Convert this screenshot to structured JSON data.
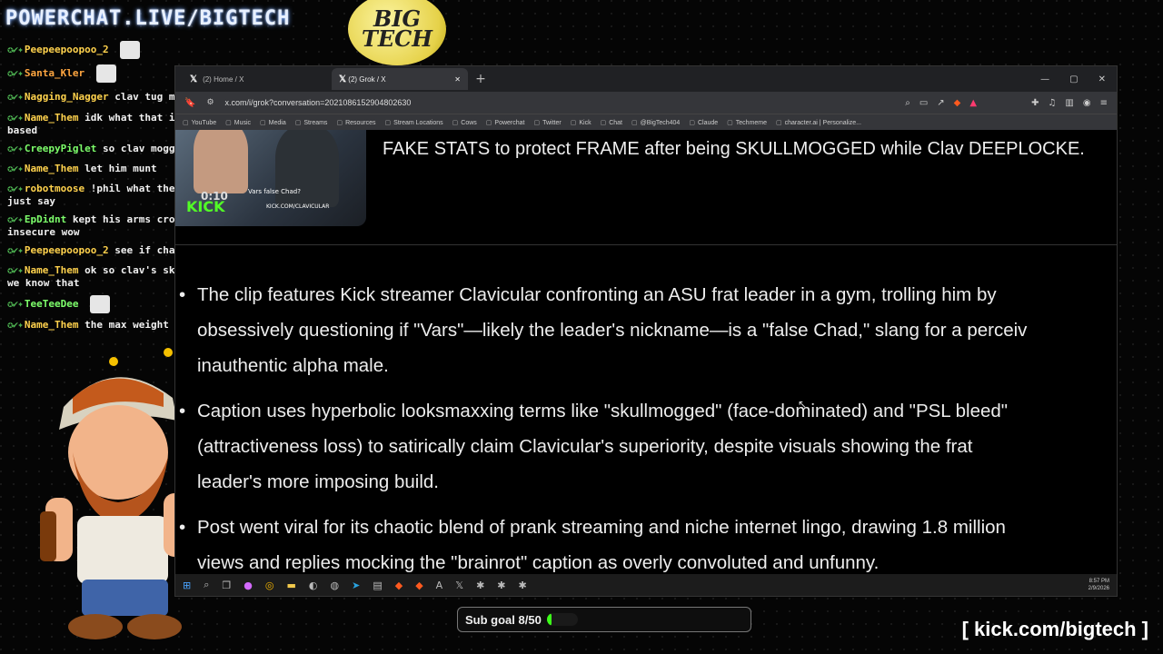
{
  "overlay": {
    "stream_title": "POWERCHAT.LIVE/BIGTECH",
    "logo_text": [
      "BIG",
      "TECH"
    ],
    "kick_link": "[ kick.com/bigtech ]"
  },
  "chat": [
    {
      "user": "Peepeepoopoo_2",
      "msg": "",
      "color": "yellow",
      "emote": true
    },
    {
      "user": "Santa_Kler",
      "msg": "",
      "color": "orange",
      "emote": true
    },
    {
      "user": "Nagging_Nagger",
      "msg": "clav tug maxxes",
      "color": "yellow",
      "emote": true
    },
    {
      "user": "Name_Them",
      "msg": "idk what that is but it sounds based",
      "color": "yellow",
      "emote": false
    },
    {
      "user": "CreepyPiglet",
      "msg": "so clav mogged or got????",
      "color": "green",
      "emote": false
    },
    {
      "user": "Name_Them",
      "msg": "let him munt",
      "color": "yellow",
      "emote": false
    },
    {
      "user": "robotmoose",
      "msg": "!phil what the fuck did you just say",
      "color": "yellow",
      "emote": false
    },
    {
      "user": "EpDidnt",
      "msg": "kept his arms crossed so insecure wow",
      "color": "green",
      "emote": false
    },
    {
      "user": "Peepeepoopoo_2",
      "msg": "see if chatgpt knows",
      "color": "yellow",
      "emote": false
    },
    {
      "user": "Name_Them",
      "msg": "ok so clav's skull is better we know that",
      "color": "yellow",
      "emote": false
    },
    {
      "user": "TeeTeeDee",
      "msg": "",
      "color": "green",
      "emote": true
    },
    {
      "user": "Name_Them",
      "msg": "the max weight was a cope",
      "color": "yellow",
      "emote": false
    }
  ],
  "browser": {
    "tabs": [
      {
        "label": "(2) Home / X",
        "active": false
      },
      {
        "label": "(2) Grok / X",
        "active": true
      }
    ],
    "url": "x.com/i/grok?conversation=2021086152904802630",
    "bookmarks": [
      "YouTube",
      "Music",
      "Media",
      "Streams",
      "Resources",
      "Stream Locations",
      "Cows",
      "Powerchat",
      "Twitter",
      "Kick",
      "Chat",
      "@BigTech404",
      "Claude",
      "Techmeme",
      "character.ai | Personalize..."
    ]
  },
  "grok": {
    "video_caption": "Vars false Chad?",
    "video_time": "0:10",
    "video_brand": "KICK",
    "video_url": "KICK.COM/CLAVICULAR",
    "headline": "FAKE STATS to protect FRAME after being SKULLMOGGED while Clav DEEPLOCKE.",
    "bullets": [
      [
        "The clip features Kick streamer Clavicular confronting an ASU frat leader in a gym, trolling him by",
        "obsessively questioning if \"Vars\"—likely the leader's nickname—is a \"false Chad,\" slang for a perceiv",
        "inauthentic alpha male."
      ],
      [
        "Caption uses hyperbolic looksmaxxing terms like \"skullmogged\" (face-dominated) and \"PSL bleed\"",
        "(attractiveness loss) to satirically claim Clavicular's superiority, despite visuals showing the frat",
        "leader's more imposing build."
      ],
      [
        "Post went viral for its chaotic blend of prank streaming and niche internet lingo, drawing 1.8 million",
        "views and replies mocking the \"brainrot\" caption as overly convoluted and unfunny."
      ]
    ]
  },
  "taskbar": {
    "time": "8:57 PM",
    "date": "2/9/2026"
  },
  "subgoal": {
    "label": "Sub goal 8/50",
    "progress": 0.16,
    "color": "#3cff19"
  }
}
